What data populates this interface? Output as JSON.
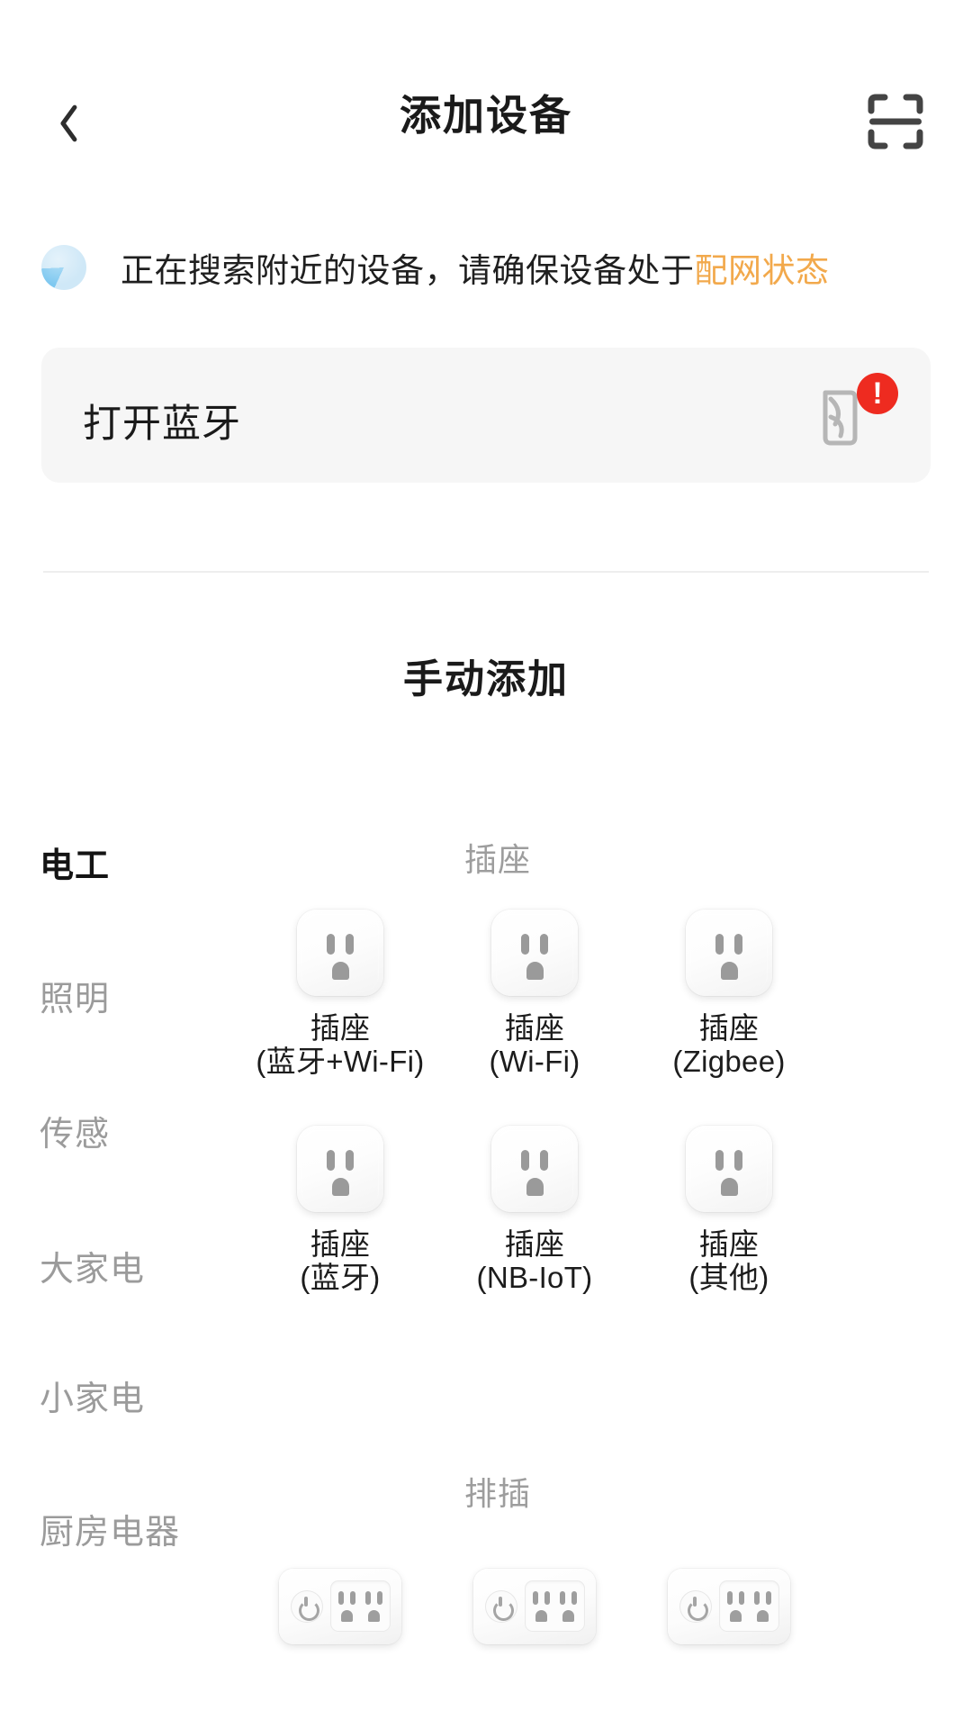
{
  "header": {
    "title": "添加设备",
    "back_icon": "chevron-left-icon",
    "scan_icon": "scan-qr-icon"
  },
  "status": {
    "spinner_icon": "loading-spinner-icon",
    "text_main": "正在搜索附近的设备，请确保设备处于",
    "text_accent": "配网状态",
    "accent_color": "#f2a94c"
  },
  "bluetooth_card": {
    "label": "打开蓝牙",
    "icon": "bluetooth-icon",
    "badge": "!",
    "badge_color": "#ee2b20",
    "background": "#f6f6f6"
  },
  "manual_add": {
    "title": "手动添加"
  },
  "sidebar": {
    "items": [
      {
        "label": "电工",
        "active": true
      },
      {
        "label": "照明",
        "active": false
      },
      {
        "label": "传感",
        "active": false
      },
      {
        "label": "大家电",
        "active": false
      },
      {
        "label": "小家电",
        "active": false
      },
      {
        "label": "厨房电器",
        "active": false
      }
    ]
  },
  "sections": [
    {
      "label": "插座",
      "tiles": [
        {
          "icon": "socket-icon",
          "name": "插座",
          "variant": "(蓝牙+Wi-Fi)"
        },
        {
          "icon": "socket-icon",
          "name": "插座",
          "variant": "(Wi-Fi)"
        },
        {
          "icon": "socket-icon",
          "name": "插座",
          "variant": "(Zigbee)"
        },
        {
          "icon": "socket-icon",
          "name": "插座",
          "variant": "(蓝牙)"
        },
        {
          "icon": "socket-icon",
          "name": "插座",
          "variant": "(NB-IoT)"
        },
        {
          "icon": "socket-icon",
          "name": "插座",
          "variant": "(其他)"
        }
      ]
    },
    {
      "label": "排插",
      "tiles": [
        {
          "icon": "power-strip-icon",
          "name": "",
          "variant": ""
        },
        {
          "icon": "power-strip-icon",
          "name": "",
          "variant": ""
        },
        {
          "icon": "power-strip-icon",
          "name": "",
          "variant": ""
        }
      ]
    }
  ],
  "captions": {
    "c0": "插座\n(蓝牙+Wi-Fi)",
    "c1": "插座\n(Wi-Fi)",
    "c2": "插座\n(Zigbee)",
    "c3": "插座\n(蓝牙)",
    "c4": "插座\n(NB-IoT)",
    "c5": "插座\n(其他)"
  }
}
